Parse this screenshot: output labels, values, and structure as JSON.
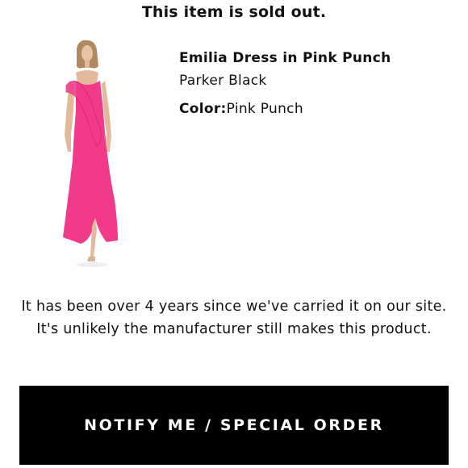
{
  "banner": {
    "title": "This item is sold out."
  },
  "product": {
    "name": "Emilia Dress in Pink Punch",
    "brand": "Parker Black",
    "color_label": "Color:",
    "color_value": "Pink Punch",
    "dress_color": "#f23a8a"
  },
  "message": {
    "text": "It has been over 4 years since we've carried it on our site. It's unlikely the manufacturer still makes this product."
  },
  "cta": {
    "label": "NOTIFY ME / SPECIAL ORDER"
  }
}
